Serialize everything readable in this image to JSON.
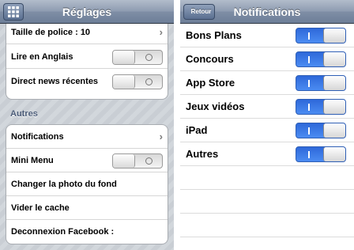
{
  "left_screen": {
    "title": "Réglages",
    "grid_icon": "app-grid-icon",
    "group1_rows": [
      {
        "label": "Taille de police : 10",
        "control": "chevron"
      },
      {
        "label": "Lire en Anglais",
        "control": "toggle",
        "state": "off"
      },
      {
        "label": "Direct news récentes",
        "control": "toggle",
        "state": "off"
      }
    ],
    "section_title": "Autres",
    "group2_rows": [
      {
        "label": "Notifications",
        "control": "chevron"
      },
      {
        "label": "Mini Menu",
        "control": "toggle",
        "state": "off"
      },
      {
        "label": "Changer la photo du fond",
        "control": "none"
      },
      {
        "label": "Vider le cache",
        "control": "none"
      },
      {
        "label": "Deconnexion Facebook :",
        "control": "none"
      }
    ],
    "chevron_glyph": "›"
  },
  "right_screen": {
    "title": "Notifications",
    "back_label": "Retour",
    "rows": [
      {
        "label": "Bons Plans",
        "state": "on"
      },
      {
        "label": "Concours",
        "state": "on"
      },
      {
        "label": "App Store",
        "state": "on"
      },
      {
        "label": "Jeux vidéos",
        "state": "on"
      },
      {
        "label": "iPad",
        "state": "on"
      },
      {
        "label": "Autres",
        "state": "on"
      }
    ]
  },
  "colors": {
    "navbar": "#7f8ea6",
    "toggle_on": "#3a7ae6",
    "section_header": "#4c5d79"
  }
}
